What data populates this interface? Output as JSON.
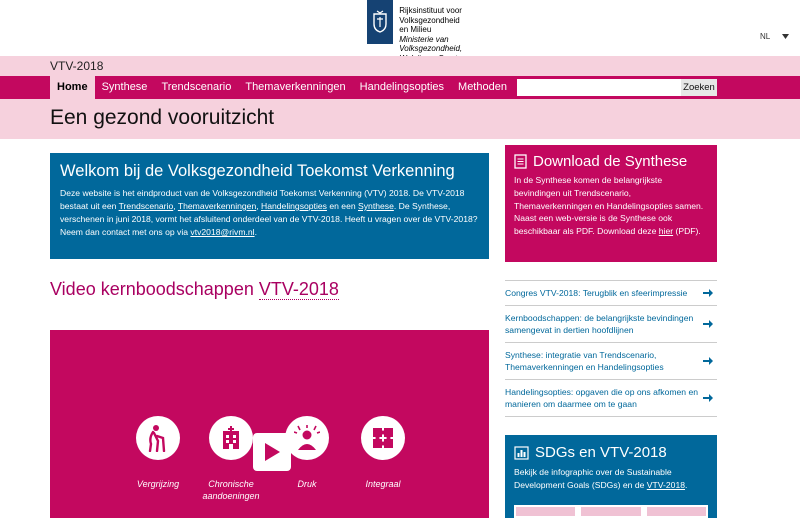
{
  "header": {
    "logo_line1": "Rijksinstituut voor Volksgezondheid",
    "logo_line2": "en Milieu",
    "logo_line3": "Ministerie van Volksgezondheid,",
    "logo_line4": "Welzijn en Sport",
    "language": "NL"
  },
  "site": {
    "title": "VTV-2018"
  },
  "nav": {
    "items": [
      "Home",
      "Synthese",
      "Trendscenario",
      "Themaverkenningen",
      "Handelingsopties",
      "Methoden"
    ],
    "search_button": "Zoeken",
    "search_placeholder": ""
  },
  "page": {
    "title": "Een gezond vooruitzicht"
  },
  "welcome": {
    "heading": "Welkom bij de Volksgezondheid Toekomst Verkenning",
    "t1": "Deze website is het eindproduct van de Volksgezondheid Toekomst Verkenning (VTV) 2018. De VTV-2018 bestaat uit een ",
    "link1": "Trendscenario",
    "sep1": ", ",
    "link2": "Themaverkenningen",
    "sep2": ", ",
    "link3": "Handelingsopties",
    "t2": " en een ",
    "link4": "Synthese",
    "t3": ". De Synthese, verschenen in juni 2018, vormt het afsluitend onderdeel van de VTV-2018. Heeft u vragen over de VTV-2018? Neem dan contact met ons op via ",
    "email": "vtv2018@rivm.nl",
    "t4": "."
  },
  "video": {
    "heading_start": "Video kernboodschappen ",
    "heading_dotted": "VTV-2018",
    "icons": [
      {
        "label": "Vergrijzing",
        "icon": "elderly-person-icon"
      },
      {
        "label": "Chronische aandoeningen",
        "icon": "hospital-icon"
      },
      {
        "label": "Druk",
        "icon": "stressed-person-icon"
      },
      {
        "label": "Integraal",
        "icon": "puzzle-icon"
      }
    ]
  },
  "download": {
    "heading": "Download de Synthese",
    "t1": "In de Synthese komen de belangrijkste bevindingen uit Trendscenario, Themaverkenningen en Handelingsopties samen.  Naast een web-versie is de Synthese ook beschikbaar als PDF. Download deze ",
    "link": "hier",
    "t2": " (PDF)."
  },
  "links": [
    "Congres VTV-2018: Terugblik en sfeerimpressie",
    "Kernboodschappen: de belangrijkste bevindingen samengevat in dertien hoofdlijnen",
    "Synthese: integratie van Trendscenario, Themaverkenningen en Handelingsopties",
    "Handelingsopties: opgaven die op ons afkomen en manieren om daarmee om te gaan"
  ],
  "sdg": {
    "heading": "SDGs en VTV-2018",
    "t1": "Bekijk de infographic over de Sustainable Development Goals (SDGs) en de ",
    "link": "VTV-2018",
    "t2": "."
  },
  "colors": {
    "magenta": "#c3085f",
    "pink_light": "#f6d1dd",
    "blue": "#01689b",
    "rijks_blue": "#154273"
  }
}
